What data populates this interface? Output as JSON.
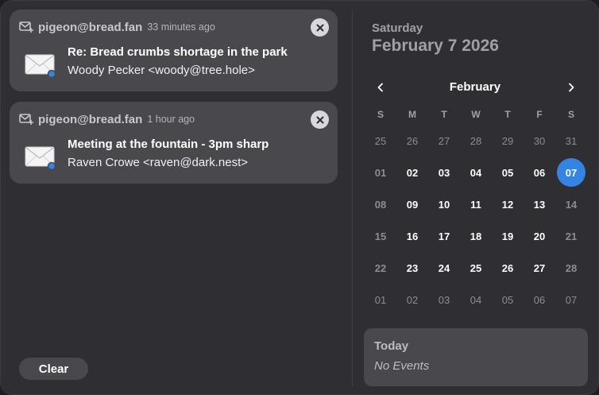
{
  "notifications": [
    {
      "account": "pigeon@bread.fan",
      "time": "33 minutes ago",
      "subject": "Re: Bread crumbs shortage in the park",
      "from": "Woody Pecker <woody@tree.hole>",
      "icon": "mail-icon"
    },
    {
      "account": "pigeon@bread.fan",
      "time": "1 hour ago",
      "subject": "Meeting at the fountain - 3pm sharp",
      "from": "Raven Crowe <raven@dark.nest>",
      "icon": "mail-icon"
    }
  ],
  "clear_label": "Clear",
  "calendar": {
    "weekday": "Saturday",
    "full_date": "February 7 2026",
    "month": "February",
    "day_headers": [
      "S",
      "M",
      "T",
      "W",
      "T",
      "F",
      "S"
    ],
    "weeks": [
      [
        "25",
        "26",
        "27",
        "28",
        "29",
        "30",
        "31"
      ],
      [
        "01",
        "02",
        "03",
        "04",
        "05",
        "06",
        "07"
      ],
      [
        "08",
        "09",
        "10",
        "11",
        "12",
        "13",
        "14"
      ],
      [
        "15",
        "16",
        "17",
        "18",
        "19",
        "20",
        "21"
      ],
      [
        "22",
        "23",
        "24",
        "25",
        "26",
        "27",
        "28"
      ],
      [
        "01",
        "02",
        "03",
        "04",
        "05",
        "06",
        "07"
      ]
    ],
    "today": "07"
  },
  "events": {
    "title": "Today",
    "empty": "No Events"
  },
  "colors": {
    "accent": "#3584e4",
    "badge": "#3584e4"
  }
}
